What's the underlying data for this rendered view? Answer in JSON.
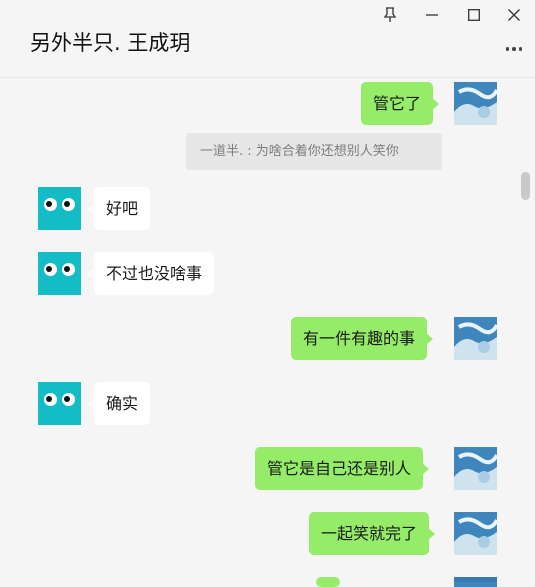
{
  "window": {
    "title": "另外半只. 王成玥"
  },
  "controls": {
    "pin_icon": "pin-icon",
    "minimize_icon": "minimize-icon",
    "maximize_icon": "maximize-icon",
    "close_icon": "close-icon",
    "more_icon": "more-icon"
  },
  "colors": {
    "me_bubble": "#95ec69",
    "peer_bubble": "#ffffff",
    "background": "#f5f5f5",
    "peer_avatar": "#14bcc6"
  },
  "messages": [
    {
      "sender": "me",
      "text": "管它了"
    },
    {
      "type": "quote",
      "text": "一道半. : 为啥合着你还想别人笑你"
    },
    {
      "sender": "peer",
      "text": "好吧"
    },
    {
      "sender": "peer",
      "text": "不过也没啥事"
    },
    {
      "sender": "me",
      "text": "有一件有趣的事"
    },
    {
      "sender": "peer",
      "text": "确实"
    },
    {
      "sender": "me",
      "text": "管它是自己还是别人"
    },
    {
      "sender": "me",
      "text": "一起笑就完了"
    }
  ]
}
